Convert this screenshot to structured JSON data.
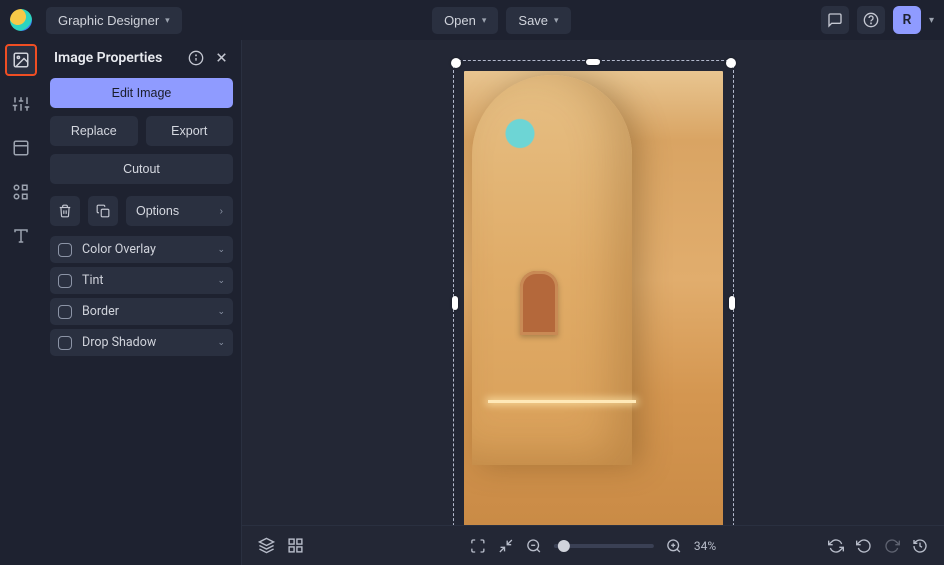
{
  "topbar": {
    "mode_label": "Graphic Designer",
    "open_label": "Open",
    "save_label": "Save",
    "avatar_letter": "R"
  },
  "panel": {
    "title": "Image Properties",
    "edit_image": "Edit Image",
    "replace": "Replace",
    "export": "Export",
    "cutout": "Cutout",
    "options": "Options",
    "accordions": [
      {
        "label": "Color Overlay"
      },
      {
        "label": "Tint"
      },
      {
        "label": "Border"
      },
      {
        "label": "Drop Shadow"
      }
    ]
  },
  "canvas": {
    "zoom_percent": "34%"
  }
}
